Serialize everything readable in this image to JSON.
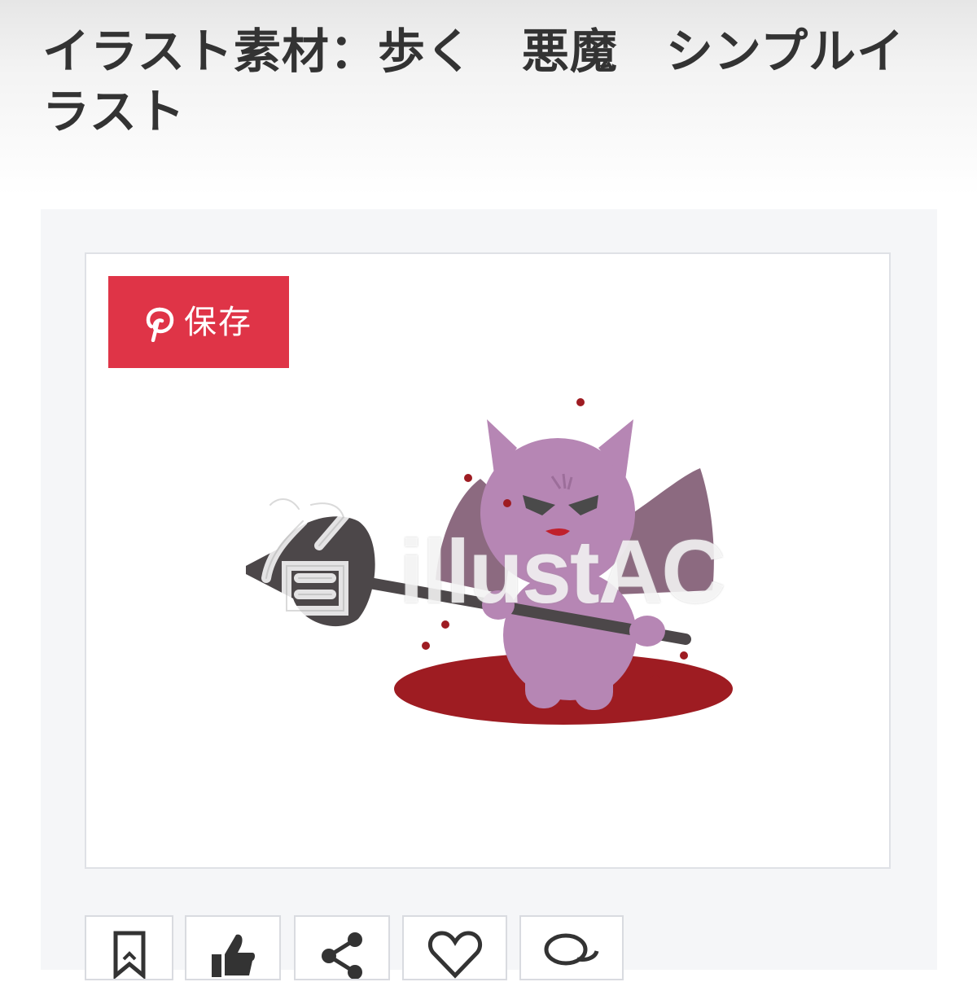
{
  "page": {
    "title": "イラスト素材：歩く　悪魔　シンプルイラスト"
  },
  "pin_button": {
    "label": "保存",
    "icon": "pinterest-icon",
    "color": "#df3447"
  },
  "illustration": {
    "watermark_text": "illustAC",
    "colors": {
      "body": "#b686b4",
      "wings": "#8c6a80",
      "blood": "#9e1c22",
      "weapon": "#4c4749"
    }
  },
  "actions": [
    {
      "icon": "bookmark-icon"
    },
    {
      "icon": "thumbs-up-icon"
    },
    {
      "icon": "share-icon"
    },
    {
      "icon": "heart-icon"
    },
    {
      "icon": "comment-icon"
    }
  ]
}
